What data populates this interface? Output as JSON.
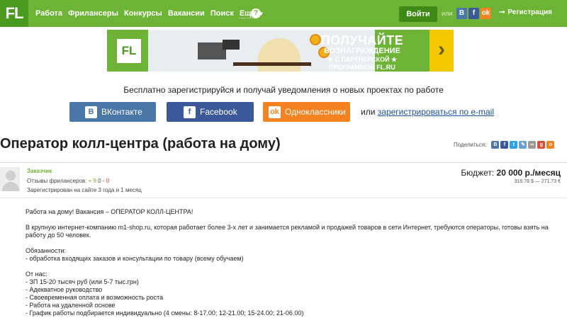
{
  "header": {
    "logo": "FL",
    "nav": [
      "Работа",
      "Фрилансеры",
      "Конкурсы",
      "Вакансии",
      "Поиск"
    ],
    "more": "Еще",
    "help": "?",
    "login": "Войти",
    "or": "или",
    "social": [
      {
        "icon": "vk-icon",
        "glyph": "В",
        "color": "#4a76a8"
      },
      {
        "icon": "facebook-icon",
        "glyph": "f",
        "color": "#3b5998"
      },
      {
        "icon": "odnoklassniki-icon",
        "glyph": "ok",
        "color": "#f58220"
      }
    ],
    "register": "Регистрация"
  },
  "banner": {
    "logo": "FL",
    "line1": "ПОЛУЧАЙТЕ",
    "line2": "ВОЗНАГРАЖДЕНИЕ",
    "line3": "★ С ПАРТНЕРСКОЙ ★",
    "line4": "ПРОГРАММОЙ FL.RU",
    "arrow": "›"
  },
  "register_block": {
    "message": "Бесплатно зарегистрируйся и получай уведомления о новых проектах по работе",
    "vk": "ВКонтакте",
    "facebook": "Facebook",
    "ok": "Одноклассники",
    "or": "или",
    "email_link": "зарегистрироваться по e-mail"
  },
  "project": {
    "title": "Оператор колл-центра (работа на дому)",
    "share_label": "Поделиться:"
  },
  "employer": {
    "role": "Заказчик",
    "reviews_label": "Отзывы фрилансеров:",
    "reviews_pos": "+ 9",
    "reviews_neutral": "0",
    "reviews_neg": "0",
    "registered": "Зарегистрирован на сайте 3 года и 1 месяц"
  },
  "budget": {
    "label": "Бюджет:",
    "value": "20 000 р./месяц",
    "converted": "316.78 $ — 271.73 €"
  },
  "description": {
    "intro": "Работа на дому! Вакансия – ОПЕРАТОР КОЛЛ-ЦЕНТРА!",
    "p1": "В крупную интернет-компанию m1-shop.ru, которая работает более 3-х лет и занимается рекламой и продажей товаров в сети Интернет, требуются операторы, готовы взять на работу до 50 человек.",
    "duties_title": "Обязанности:",
    "duties": [
      "- обработка входящих заказов и консультации по товару (всему обучаем)"
    ],
    "offer_title": "От нас:",
    "offer": [
      "- ЗП 15-20 тысяч руб (или 5-7 тыс.грн)",
      "- Адекватное руководство",
      "- Своевременная оплата и возможность роста",
      "- Работа на удаленной основе",
      "- График работы подбирается индивидуально (4 смены: 8-17.00; 12-21.00; 15-24.00; 21-06.00)"
    ]
  },
  "colors": {
    "brand_green": "#6db335",
    "dark_green": "#3e8a16",
    "vk": "#4a76a8",
    "facebook": "#3b5998",
    "ok": "#f58220",
    "link": "#1b4fa0",
    "banner_yellow": "#f3c800"
  }
}
